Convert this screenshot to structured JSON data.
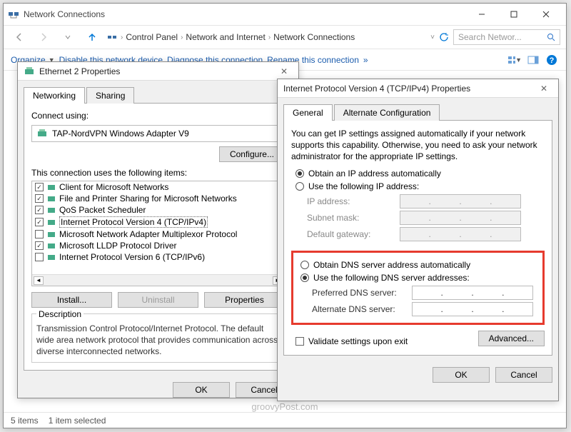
{
  "main_window": {
    "title": "Network Connections",
    "breadcrumbs": [
      "Control Panel",
      "Network and Internet",
      "Network Connections"
    ],
    "search_placeholder": "Search Networ..."
  },
  "toolbar": {
    "organize": "Organize",
    "disable": "Disable this network device",
    "diagnose": "Diagnose this connection",
    "rename": "Rename this connection"
  },
  "statusbar": {
    "items": "5 items",
    "selected": "1 item selected"
  },
  "watermark": "groovyPost.com",
  "eth_dialog": {
    "title": "Ethernet 2 Properties",
    "tabs": {
      "networking": "Networking",
      "sharing": "Sharing"
    },
    "connect_using_label": "Connect using:",
    "adapter": "TAP-NordVPN Windows Adapter V9",
    "configure_btn": "Configure...",
    "items_label": "This connection uses the following items:",
    "items": [
      {
        "checked": true,
        "label": "Client for Microsoft Networks"
      },
      {
        "checked": true,
        "label": "File and Printer Sharing for Microsoft Networks"
      },
      {
        "checked": true,
        "label": "QoS Packet Scheduler"
      },
      {
        "checked": true,
        "label": "Internet Protocol Version 4 (TCP/IPv4)",
        "selected": true
      },
      {
        "checked": false,
        "label": "Microsoft Network Adapter Multiplexor Protocol"
      },
      {
        "checked": true,
        "label": "Microsoft LLDP Protocol Driver"
      },
      {
        "checked": false,
        "label": "Internet Protocol Version 6 (TCP/IPv6)"
      }
    ],
    "install_btn": "Install...",
    "uninstall_btn": "Uninstall",
    "properties_btn": "Properties",
    "description_label": "Description",
    "description_text": "Transmission Control Protocol/Internet Protocol. The default wide area network protocol that provides communication across diverse interconnected networks.",
    "ok": "OK",
    "cancel": "Cancel"
  },
  "ipv4_dialog": {
    "title": "Internet Protocol Version 4 (TCP/IPv4) Properties",
    "tabs": {
      "general": "General",
      "alternate": "Alternate Configuration"
    },
    "help_text": "You can get IP settings assigned automatically if your network supports this capability. Otherwise, you need to ask your network administrator for the appropriate IP settings.",
    "ip_auto": "Obtain an IP address automatically",
    "ip_manual": "Use the following IP address:",
    "ip_address": "IP address:",
    "subnet": "Subnet mask:",
    "gateway": "Default gateway:",
    "dns_auto": "Obtain DNS server address automatically",
    "dns_manual": "Use the following DNS server addresses:",
    "pref_dns": "Preferred DNS server:",
    "alt_dns": "Alternate DNS server:",
    "validate": "Validate settings upon exit",
    "advanced": "Advanced...",
    "ok": "OK",
    "cancel": "Cancel"
  }
}
